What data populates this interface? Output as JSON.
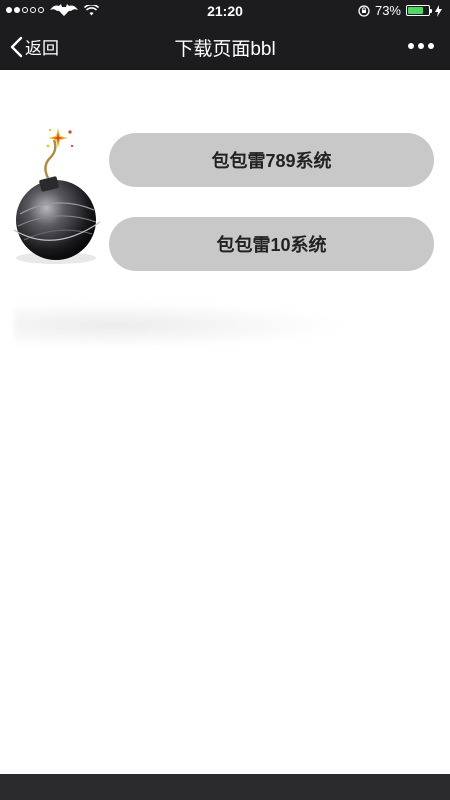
{
  "status_bar": {
    "carrier_icon": "batman-logo-icon",
    "time": "21:20",
    "battery_percent": "73%",
    "battery_level": 0.73,
    "colors": {
      "battery_fill": "#4cd964"
    }
  },
  "nav": {
    "back_label": "返回",
    "title": "下载页面bbl",
    "more_icon": "ellipsis-icon"
  },
  "main": {
    "illustration_icon": "bomb-icon",
    "buttons": [
      {
        "label": "包包雷789系统"
      },
      {
        "label": "包包雷10系统"
      }
    ]
  },
  "colors": {
    "nav_background": "#1c1c1e",
    "button_background": "#c8c8c8",
    "page_background": "#ffffff"
  }
}
